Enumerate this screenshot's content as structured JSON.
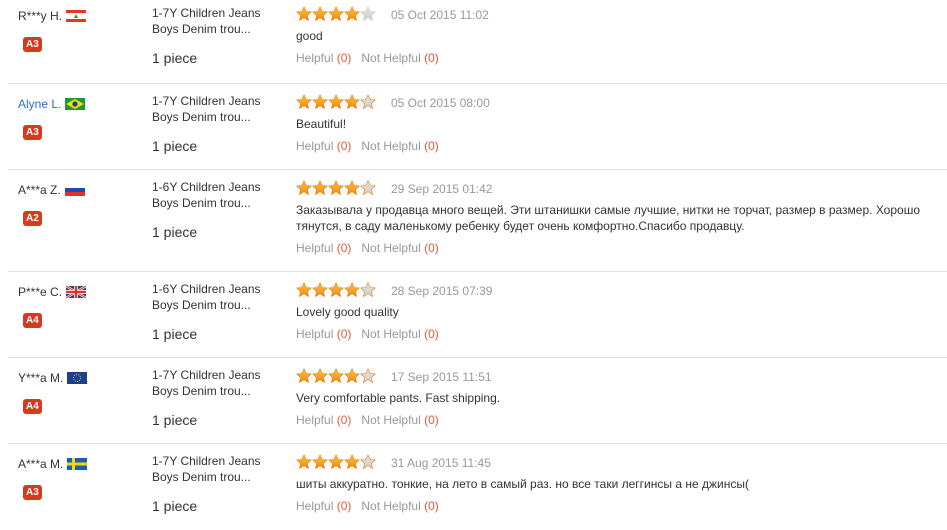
{
  "colors": {
    "accent_orange": "#f5a623",
    "badge_red": "#d93a1f",
    "link_blue": "#2a6ebb",
    "count_red": "#e4593a"
  },
  "helpful_label": "Helpful",
  "not_helpful_label": "Not Helpful",
  "reviews": [
    {
      "user": "R***y H.",
      "flag": "lebanon-flag-icon",
      "badge": "A3",
      "product": [
        "1-7Y Children Jeans",
        "Boys Denim trou..."
      ],
      "qty": "1 piece",
      "stars": 4,
      "date": "05 Oct 2015 11:02",
      "text": "good",
      "helpful": "(0)",
      "not_helpful": "(0)"
    },
    {
      "user": "Alyne L.",
      "flag": "brazil-flag-icon",
      "badge": "A3",
      "product": [
        "1-7Y Children Jeans",
        "Boys Denim trou..."
      ],
      "qty": "1 piece",
      "stars": 5,
      "date": "05 Oct 2015 08:00",
      "text": "Beautiful!",
      "helpful": "(0)",
      "not_helpful": "(0)"
    },
    {
      "user": "A***a Z.",
      "flag": "russia-flag-icon",
      "badge": "A2",
      "product": [
        "1-6Y Children Jeans",
        "Boys Denim trou..."
      ],
      "qty": "1 piece",
      "stars": 5,
      "date": "29 Sep 2015 01:42",
      "text": "Заказывала у продавца много вещей. Эти штанишки самые лучшие, нитки не торчат, размер в размер. Хорошо тянутся, в саду маленькому ребенку будет очень комфортно.Спасибо продавцу.",
      "helpful": "(0)",
      "not_helpful": "(0)"
    },
    {
      "user": "P***e C.",
      "flag": "uk-flag-icon",
      "badge": "A4",
      "product": [
        "1-6Y Children Jeans",
        "Boys Denim trou..."
      ],
      "qty": "1 piece",
      "stars": 5,
      "date": "28 Sep 2015 07:39",
      "text": "Lovely good quality",
      "helpful": "(0)",
      "not_helpful": "(0)"
    },
    {
      "user": "Y***a M.",
      "flag": "eu-flag-icon",
      "badge": "A4",
      "product": [
        "1-7Y Children Jeans",
        "Boys Denim trou..."
      ],
      "qty": "1 piece",
      "stars": 5,
      "date": "17 Sep 2015 11:51",
      "text": "Very comfortable pants. Fast shipping.",
      "helpful": "(0)",
      "not_helpful": "(0)"
    },
    {
      "user": "A***a M.",
      "flag": "sweden-flag-icon",
      "badge": "A3",
      "product": [
        "1-7Y Children Jeans",
        "Boys Denim trou..."
      ],
      "qty": "1 piece",
      "stars": 5,
      "date": "31 Aug 2015 11:45",
      "text": "шиты аккуратно. тонкие, на лето в самый раз. но все таки леггинсы а не джинсы(",
      "helpful": "(0)",
      "not_helpful": "(0)"
    }
  ]
}
